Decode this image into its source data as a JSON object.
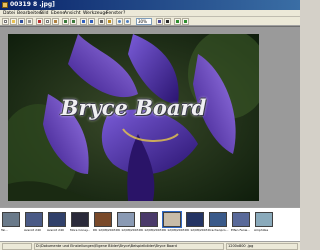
{
  "window": {
    "title": "00319 8 .jpg]"
  },
  "menu": [
    "Datei",
    "Bearbeiten",
    "Bild",
    "Ebene",
    "Ansicht",
    "Werkzeuge",
    "Fenster",
    "?"
  ],
  "toolbar": {
    "zoom": "30%"
  },
  "photo": {
    "caption": "Bryce Board"
  },
  "thumbnails": [
    {
      "label": "Tai...",
      "color": "#6a7a8a"
    },
    {
      "label": "Avsroit 240",
      "color": "#4a5a86"
    },
    {
      "label": "Avsroit 240",
      "color": "#30406a"
    },
    {
      "label": "More Coney...",
      "color": "#2a2a3a"
    },
    {
      "label": "DK 12/08/2003",
      "color": "#7a4a2a"
    },
    {
      "label": "DK 12/08/2003",
      "color": "#8a9ab4"
    },
    {
      "label": "DK 12/08/2003",
      "color": "#4a3a6a"
    },
    {
      "label": "DK 12/08/2003",
      "color": "#c8bca8"
    },
    {
      "label": "DK 12/08/2003",
      "color": "#243464"
    },
    {
      "label": "Drachenpro...",
      "color": "#3a5a8a"
    },
    {
      "label": "Elfen Fenw...",
      "color": "#5a6a9a"
    },
    {
      "label": "Amphibie",
      "color": "#8aaabb"
    }
  ],
  "status": {
    "path": "D:\\Dokumente und Einstellungen\\Eigene Bilder\\Bryce\\Beispielbilder\\Bryce Board",
    "info": "1200x800 .jpg"
  },
  "colors": {
    "titlebar": "#0a246a",
    "menubar": "#ece9d8",
    "viewer": "#9a9a9a",
    "selection": "#316ac5"
  }
}
